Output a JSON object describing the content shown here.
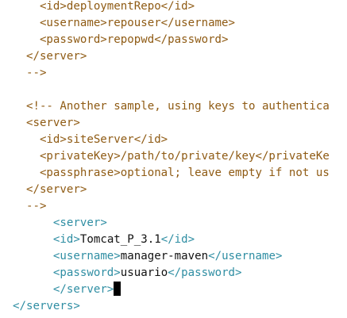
{
  "colors": {
    "tag": "#2f8ea3",
    "comment": "#8f5b14",
    "text": "#111111",
    "cursor": "#000000"
  },
  "lines": [
    {
      "parts": [
        {
          "t": "c",
          "v": "    <id>deploymentRepo</id>"
        }
      ]
    },
    {
      "parts": [
        {
          "t": "c",
          "v": "    <username>repouser</username>"
        }
      ]
    },
    {
      "parts": [
        {
          "t": "c",
          "v": "    <password>repopwd</password>"
        }
      ]
    },
    {
      "parts": [
        {
          "t": "c",
          "v": "  </server>"
        }
      ]
    },
    {
      "parts": [
        {
          "t": "c",
          "v": "  -->"
        }
      ]
    },
    {
      "parts": []
    },
    {
      "parts": [
        {
          "t": "c",
          "v": "  <!-- Another sample, using keys to authentica"
        }
      ]
    },
    {
      "parts": [
        {
          "t": "c",
          "v": "  <server>"
        }
      ]
    },
    {
      "parts": [
        {
          "t": "c",
          "v": "    <id>siteServer</id>"
        }
      ]
    },
    {
      "parts": [
        {
          "t": "c",
          "v": "    <privateKey>/path/to/private/key</privateKe"
        }
      ]
    },
    {
      "parts": [
        {
          "t": "c",
          "v": "    <passphrase>optional; leave empty if not us"
        }
      ]
    },
    {
      "parts": [
        {
          "t": "c",
          "v": "  </server>"
        }
      ]
    },
    {
      "parts": [
        {
          "t": "c",
          "v": "  -->"
        }
      ]
    },
    {
      "parts": [
        {
          "t": "s",
          "v": "      "
        },
        {
          "t": "t",
          "v": "<server>"
        }
      ]
    },
    {
      "parts": [
        {
          "t": "s",
          "v": "      "
        },
        {
          "t": "t",
          "v": "<id>"
        },
        {
          "t": "x",
          "v": "Tomcat_P_3.1"
        },
        {
          "t": "t",
          "v": "</id>"
        }
      ]
    },
    {
      "parts": [
        {
          "t": "s",
          "v": "      "
        },
        {
          "t": "t",
          "v": "<username>"
        },
        {
          "t": "x",
          "v": "manager-maven"
        },
        {
          "t": "t",
          "v": "</username>"
        }
      ]
    },
    {
      "parts": [
        {
          "t": "s",
          "v": "      "
        },
        {
          "t": "t",
          "v": "<password>"
        },
        {
          "t": "x",
          "v": "usuario"
        },
        {
          "t": "t",
          "v": "</password>"
        }
      ]
    },
    {
      "parts": [
        {
          "t": "s",
          "v": "      "
        },
        {
          "t": "t",
          "v": "</server>"
        }
      ],
      "cursor": true
    },
    {
      "parts": [
        {
          "t": "t",
          "v": "</servers>"
        }
      ]
    }
  ]
}
